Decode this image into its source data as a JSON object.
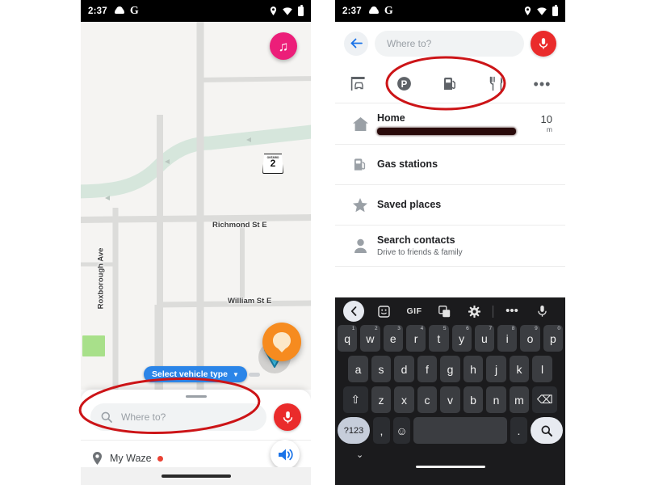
{
  "status_bar": {
    "time": "2:37",
    "icons_left": [
      "cloud-icon",
      "google-g-icon"
    ],
    "icons_right": [
      "location-pin-icon",
      "wifi-icon",
      "battery-icon"
    ]
  },
  "left_phone": {
    "map": {
      "labels": [
        {
          "text": "Richmond St E",
          "name": "map-label-richmond-st-e"
        },
        {
          "text": "William St E",
          "name": "map-label-william-st-e"
        },
        {
          "text": "Roxborough Ave",
          "name": "map-label-roxborough-ave"
        }
      ],
      "highway_shield": {
        "region": "ONTARIO",
        "number": "2"
      },
      "colors": {
        "background": "#f5f4f2",
        "road": "#dcdcda",
        "highway": "#d6e6dc",
        "park": "#a8e08a",
        "marker_blue": "#1aa7dd",
        "mood_orange": "#f68b1f",
        "music_pink": "#ec1e79"
      }
    },
    "music_button": {
      "icon": "music-note-icon"
    },
    "vehicle_pill": {
      "label": "Select vehicle type",
      "caret": "▼"
    },
    "home_marker": {
      "icon": "home-icon"
    },
    "nav_arrow": {
      "icon": "navigation-arrow-icon"
    },
    "mood_button": {
      "icon": "mood-face-icon"
    },
    "sheet": {
      "search": {
        "placeholder": "Where to?",
        "icon": "search-icon"
      },
      "mic_button": {
        "icon": "microphone-icon",
        "color": "#ea2b2b"
      },
      "my_waze": {
        "label": "My Waze",
        "icon": "map-pin-icon",
        "badge": true
      },
      "sound_button": {
        "icon": "sound-on-icon",
        "color": "#1a73e8"
      }
    }
  },
  "right_phone": {
    "search_header": {
      "back": "←",
      "placeholder": "Where to?",
      "mic": {
        "icon": "microphone-icon",
        "color": "#ea2b2b"
      }
    },
    "categories": [
      {
        "name": "category-parking-garage",
        "icon": "carport-icon"
      },
      {
        "name": "category-parking",
        "icon": "parking-p-icon"
      },
      {
        "name": "category-gas",
        "icon": "gas-pump-icon"
      },
      {
        "name": "category-food",
        "icon": "fork-knife-icon"
      },
      {
        "name": "category-more",
        "icon": "overflow-dots-icon",
        "label": "•••"
      }
    ],
    "list": [
      {
        "name": "list-item-home",
        "icon": "home-icon",
        "title": "Home",
        "subtitle_redacted": true,
        "distance": "10",
        "unit": "m"
      },
      {
        "name": "list-item-gas-stations",
        "icon": "gas-pump-icon",
        "title": "Gas stations"
      },
      {
        "name": "list-item-saved-places",
        "icon": "star-icon",
        "title": "Saved places"
      },
      {
        "name": "list-item-search-contacts",
        "icon": "contact-person-icon",
        "title": "Search contacts",
        "subtitle": "Drive to friends & family"
      }
    ],
    "keyboard": {
      "toolbar": [
        {
          "name": "kb-back-chevron",
          "glyph": "‹"
        },
        {
          "name": "kb-sticker-icon",
          "glyph": "☺"
        },
        {
          "name": "kb-gif-button",
          "glyph": "GIF"
        },
        {
          "name": "kb-translate-icon",
          "glyph": "文"
        },
        {
          "name": "kb-settings-gear-icon",
          "glyph": "⚙"
        },
        {
          "name": "kb-overflow-dots",
          "glyph": "•••"
        },
        {
          "name": "kb-mic-icon",
          "glyph": "⬤"
        }
      ],
      "row1": [
        {
          "key": "q",
          "sup": "1"
        },
        {
          "key": "w",
          "sup": "2"
        },
        {
          "key": "e",
          "sup": "3"
        },
        {
          "key": "r",
          "sup": "4"
        },
        {
          "key": "t",
          "sup": "5"
        },
        {
          "key": "y",
          "sup": "6"
        },
        {
          "key": "u",
          "sup": "7"
        },
        {
          "key": "i",
          "sup": "8"
        },
        {
          "key": "o",
          "sup": "9"
        },
        {
          "key": "p",
          "sup": "0"
        }
      ],
      "row2": [
        "a",
        "s",
        "d",
        "f",
        "g",
        "h",
        "j",
        "k",
        "l"
      ],
      "row3": [
        "z",
        "x",
        "c",
        "v",
        "b",
        "n",
        "m"
      ],
      "shift": "⇧",
      "backspace": "⌫",
      "symbols": "?123",
      "comma": ",",
      "emoji": "☺",
      "period": ".",
      "enter": "search-icon",
      "space": "",
      "dismiss": "⌄"
    }
  },
  "annotations": [
    {
      "name": "annotation-ellipse-search-bar",
      "color": "#cc1417"
    },
    {
      "name": "annotation-ellipse-categories",
      "color": "#cc1417"
    }
  ]
}
